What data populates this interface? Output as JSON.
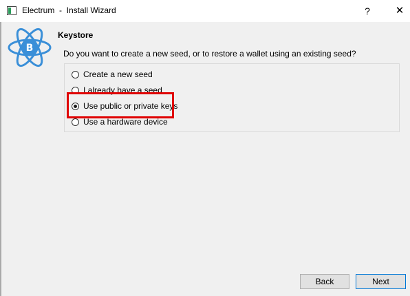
{
  "window": {
    "title": "Electrum  -  Install Wizard",
    "help_label": "?",
    "close_label": "✕"
  },
  "page": {
    "heading": "Keystore",
    "question": "Do you want to create a new seed, or to restore a wallet using an existing seed?"
  },
  "options": [
    {
      "label": "Create a new seed",
      "selected": false
    },
    {
      "label": "I already have a seed",
      "selected": false
    },
    {
      "label": "Use public or private keys",
      "selected": true
    },
    {
      "label": "Use a hardware device",
      "selected": false
    }
  ],
  "buttons": {
    "back": "Back",
    "next": "Next"
  },
  "colors": {
    "highlight": "#e00000",
    "logo": "#3a8fd8",
    "default_button_border": "#0078d7"
  }
}
